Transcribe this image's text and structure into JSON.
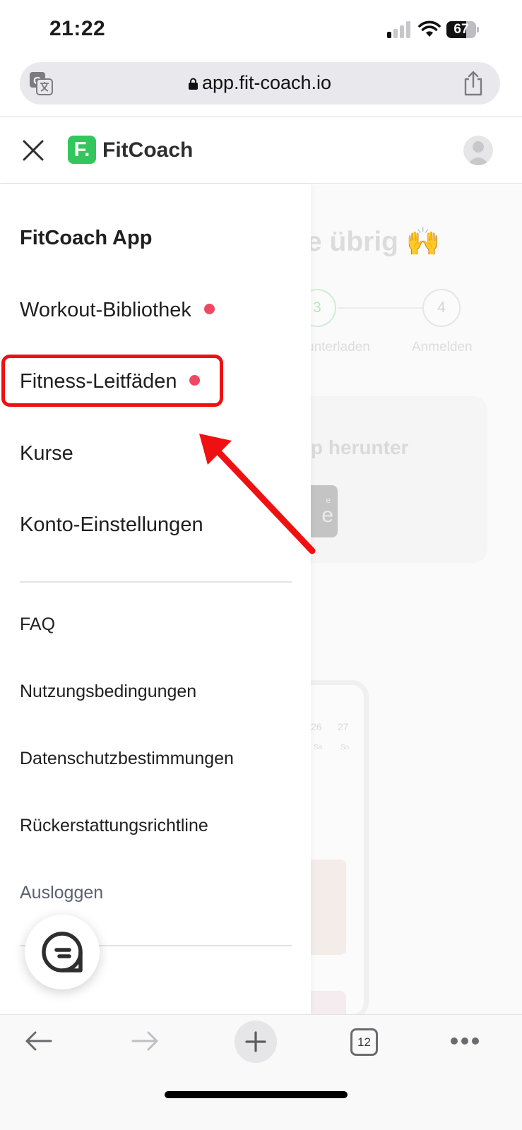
{
  "status_bar": {
    "time": "21:22",
    "battery_level": "67",
    "battery_fraction": 0.67,
    "signal_bars": 1
  },
  "browser": {
    "url": "app.fit-coach.io",
    "open_tabs": "12",
    "icons": [
      "translate-icon",
      "lock-icon",
      "share-icon",
      "back-icon",
      "forward-icon",
      "plus-icon",
      "tabs-icon",
      "more-icon"
    ]
  },
  "header": {
    "logo_letter": "F.",
    "brand": "FitCoach",
    "brand_color": "#33c65d"
  },
  "drawer": {
    "section_title": "FitCoach App",
    "items": [
      {
        "label": "Workout-Bibliothek",
        "has_dot": true
      },
      {
        "label": "Fitness-Leitfäden",
        "has_dot": true
      },
      {
        "label": "Kurse",
        "has_dot": false
      },
      {
        "label": "Konto-Einstellungen",
        "has_dot": false
      }
    ],
    "secondary_items": [
      {
        "label": "FAQ"
      },
      {
        "label": "Nutzungsbedingungen"
      },
      {
        "label": "Datenschutzbestimmungen"
      },
      {
        "label": "Rückerstattungsrichtline"
      },
      {
        "label": "Ausloggen"
      }
    ],
    "dot_color": "#ef4863"
  },
  "background_page": {
    "heading": "e übrig 🙌",
    "steps": [
      {
        "number": "3",
        "label": "unterladen"
      },
      {
        "number": "4",
        "label": "Anmelden"
      }
    ],
    "card_title": "p herunter",
    "badge_text": "e",
    "badge_caption": "e",
    "calendar_days": [
      "26",
      "27"
    ],
    "calendar_weekdays": [
      "Sa",
      "So"
    ]
  },
  "annotation": {
    "highlight_color": "#ef1111",
    "target": "Fitness-Leitfäden"
  }
}
